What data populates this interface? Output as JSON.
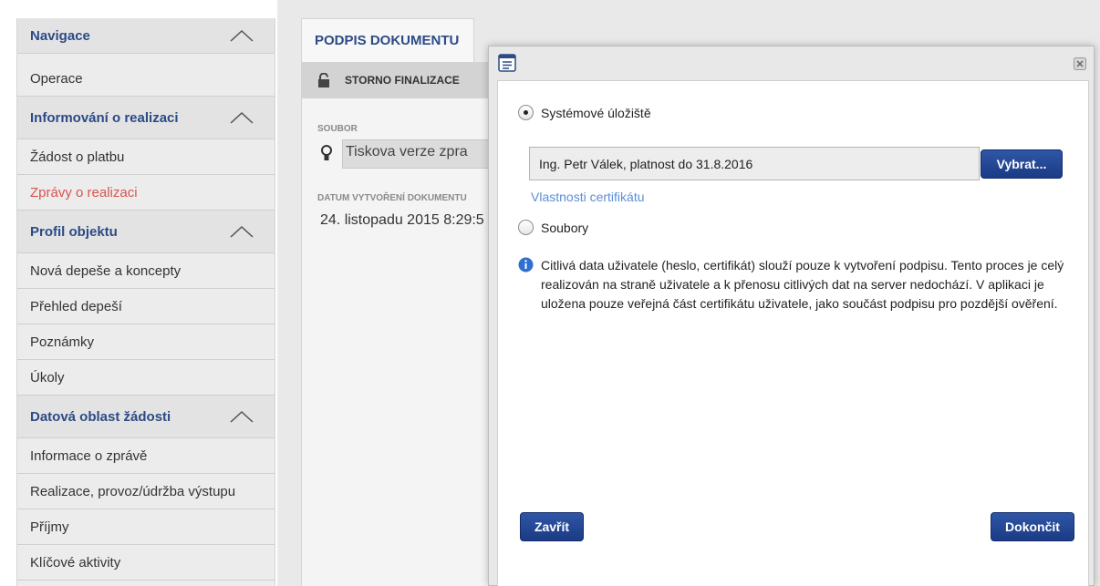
{
  "sidebar": {
    "items": [
      {
        "label": "Navigace",
        "type": "head"
      },
      {
        "label": "Operace",
        "type": "item"
      },
      {
        "label": "Informování o realizaci",
        "type": "head"
      },
      {
        "label": "Žádost o platbu",
        "type": "item"
      },
      {
        "label": "Zprávy o realizaci",
        "type": "active"
      },
      {
        "label": "Profil objektu",
        "type": "head"
      },
      {
        "label": "Nová depeše a koncepty",
        "type": "item"
      },
      {
        "label": "Přehled depeší",
        "type": "item"
      },
      {
        "label": "Poznámky",
        "type": "item"
      },
      {
        "label": "Úkoly",
        "type": "item"
      },
      {
        "label": "Datová oblast žádosti",
        "type": "head"
      },
      {
        "label": "Informace o zprávě",
        "type": "item"
      },
      {
        "label": "Realizace, provoz/údržba výstupu",
        "type": "item"
      },
      {
        "label": "Příjmy",
        "type": "item"
      },
      {
        "label": "Klíčové aktivity",
        "type": "item"
      }
    ]
  },
  "main": {
    "tab_label": "PODPIS DOKUMENTU",
    "toolbar_button": "STORNO FINALIZACE",
    "file_label": "SOUBOR",
    "file_value": "Tiskova verze zpra",
    "date_label": "DATUM VYTVOŘENÍ DOKUMENTU",
    "date_value": "24. listopadu 2015 8:29:5"
  },
  "dialog": {
    "radio_system": "Systémové úložiště",
    "certificate_value": "Ing. Petr Válek, platnost do 31.8.2016",
    "select_button": "Vybrat...",
    "cert_props_link": "Vlastnosti certifikátu",
    "radio_files": "Soubory",
    "info_text": "Citlivá data uživatele (heslo, certifikát) slouží pouze k vytvoření podpisu. Tento proces je celý realizován na straně uživatele a k přenosu citlivých dat na server nedochází. V aplikaci je uložena pouze veřejná část certifikátu uživatele, jako součást podpisu pro pozdější ověření.",
    "close_button": "Zavřít",
    "finish_button": "Dokončit"
  },
  "colors": {
    "nav_head": "#2c4a86",
    "active_item": "#d9534f",
    "button": "#1f4290",
    "link": "#5b8fd6"
  },
  "icons": [
    "chevron-up-icon",
    "lock-icon",
    "bulb-icon",
    "dialog-icon",
    "close-icon",
    "info-icon"
  ]
}
